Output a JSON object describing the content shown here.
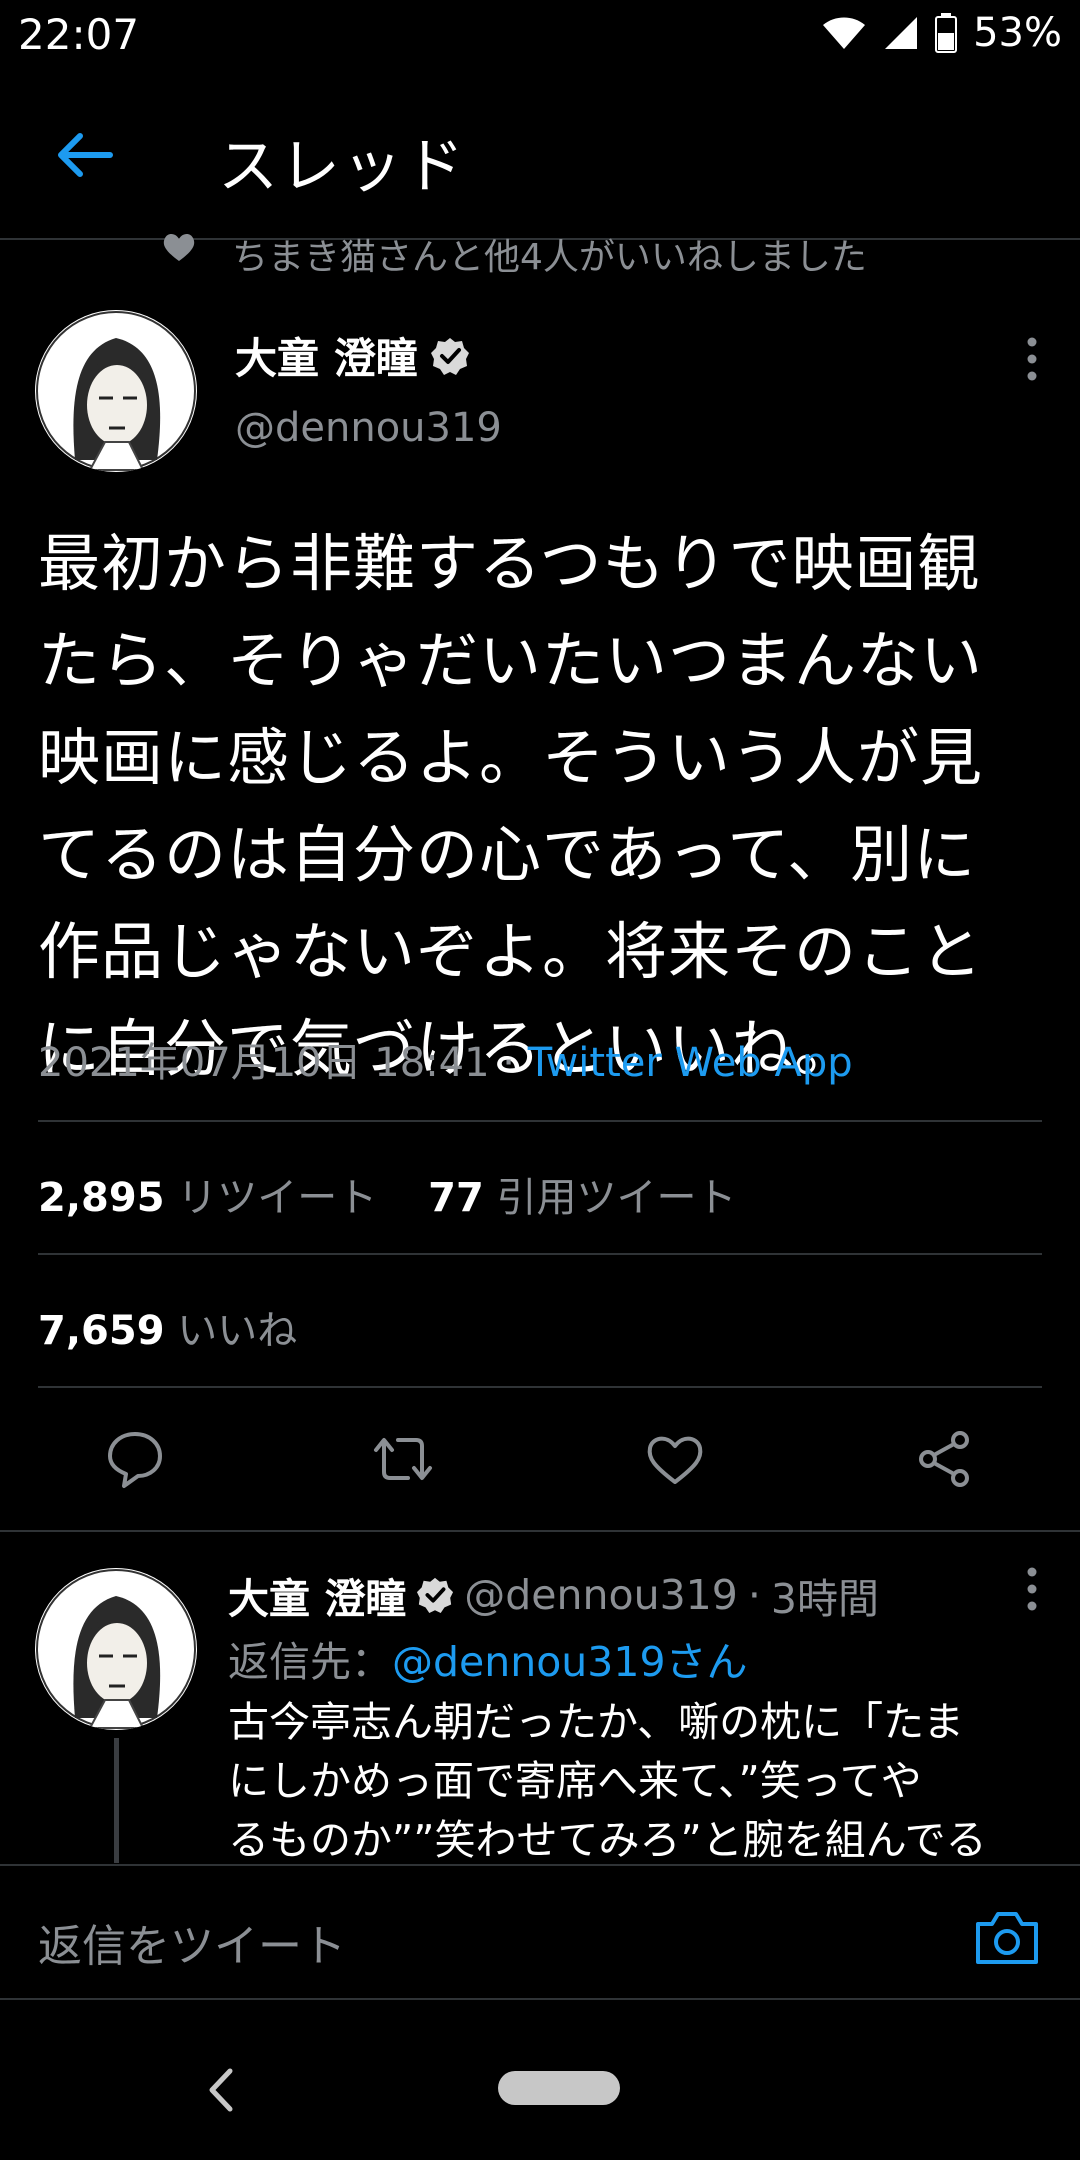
{
  "status_bar": {
    "time": "22:07",
    "battery": "53%",
    "icons": [
      "wifi-icon",
      "signal-icon",
      "battery-icon"
    ]
  },
  "header": {
    "title": "スレッド",
    "back_icon": "back-arrow-icon"
  },
  "social_context": {
    "text": "ちまき猫さんと他4人がいいねしました",
    "icon": "heart-icon"
  },
  "main_tweet": {
    "author_name": "大童 澄瞳",
    "verified": true,
    "handle": "@dennou319",
    "text_lines": [
      "最初から非難するつもりで映画観",
      "たら、そりゃだいたいつまんない",
      "映画に感じるよ。そういう人が見",
      "てるのは自分の心であって、別に",
      "作品じゃないぞよ。将来そのこと",
      "に自分で気づけるといいね。"
    ],
    "timestamp": "2021年07月10日 18:41",
    "separator": " · ",
    "source": "Twitter Web App",
    "retweets_count": "2,895",
    "retweets_label": "リツイート",
    "quotes_count": "77",
    "quotes_label": "引用ツイート",
    "likes_count": "7,659",
    "likes_label": "いいね"
  },
  "actions": [
    "reply-icon",
    "retweet-icon",
    "like-icon",
    "share-icon"
  ],
  "reply_tweet": {
    "author_name": "大童 澄瞳",
    "handle": "@dennou319",
    "time": "3時間",
    "separator": " · ",
    "reply_to_label": "返信先：",
    "reply_to_mention": "@dennou319さん",
    "text_lines": [
      "古今亭志ん朝だったか、噺の枕に「たま",
      "にしかめっ面で寄席へ来て、”笑ってや",
      "るものか””笑わせてみろ”と腕を組んでる"
    ]
  },
  "compose": {
    "placeholder": "返信をツイート"
  },
  "colors": {
    "background": "#000000",
    "accent": "#1d9bf0",
    "secondary_text": "#8b8f94",
    "divider": "#2f3336"
  }
}
